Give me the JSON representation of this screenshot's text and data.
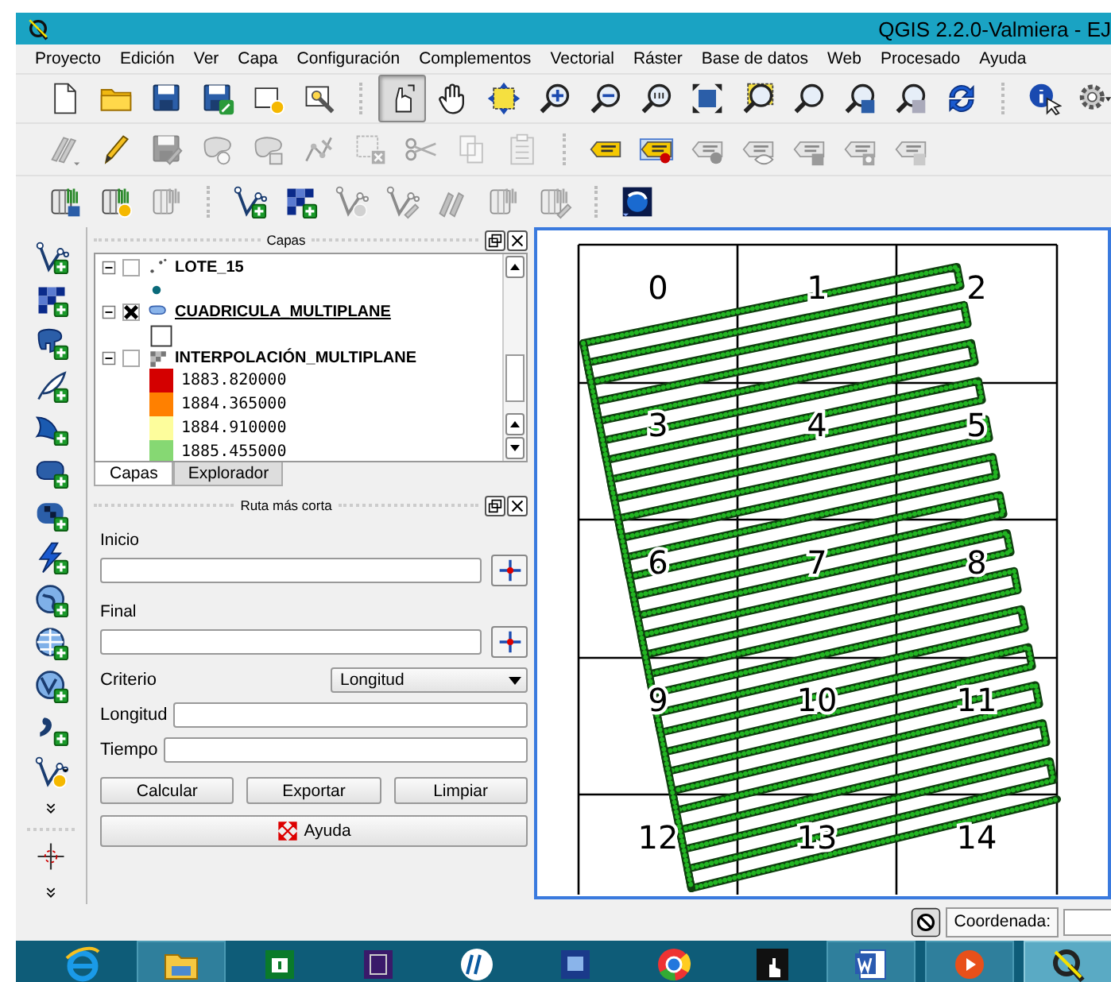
{
  "window": {
    "title": "QGIS 2.2.0-Valmiera - EJ"
  },
  "menu": [
    "Proyecto",
    "Edición",
    "Ver",
    "Capa",
    "Configuración",
    "Complementos",
    "Vectorial",
    "Ráster",
    "Base de datos",
    "Web",
    "Procesado",
    "Ayuda"
  ],
  "toolbars": [
    {
      "tools": [
        {
          "selected": false
        },
        {
          "selected": false
        },
        {
          "selected": false
        },
        {
          "selected": false
        },
        {
          "selected": false
        },
        {
          "selected": false
        },
        {
          "selected": true
        },
        {
          "selected": false
        },
        {
          "selected": false
        },
        {
          "selected": false
        },
        {
          "selected": false
        },
        {
          "selected": false
        },
        {
          "selected": false
        },
        {
          "selected": false
        },
        {
          "selected": false
        },
        {
          "selected": false
        },
        {
          "selected": false
        },
        {
          "selected": false
        },
        {
          "selected": false
        },
        {
          "selected": false
        }
      ]
    },
    {
      "tools": [
        {
          "disabled": true
        },
        {
          "disabled": false
        },
        {
          "disabled": true
        },
        {
          "disabled": true
        },
        {
          "disabled": true
        },
        {
          "disabled": true
        },
        {
          "disabled": true
        },
        {
          "disabled": true
        },
        {
          "disabled": true
        },
        {
          "disabled": true
        },
        {
          "disabled": false
        },
        {
          "disabled": false
        },
        {
          "disabled": true
        },
        {
          "disabled": true
        },
        {
          "disabled": true
        },
        {
          "disabled": true
        },
        {
          "disabled": true
        }
      ]
    },
    {
      "tools": [
        {
          "disabled": false
        },
        {
          "disabled": false
        },
        {
          "disabled": true
        },
        {
          "disabled": false
        },
        {
          "disabled": false
        },
        {
          "disabled": true
        },
        {
          "disabled": true
        },
        {
          "disabled": true
        },
        {
          "disabled": true
        },
        {
          "disabled": true
        },
        {
          "disabled": false
        }
      ]
    }
  ],
  "layers_panel": {
    "title": "Capas",
    "layers": [
      {
        "name": "LOTE_15",
        "kind": "point",
        "checked": false,
        "expanded": true,
        "selected": false
      },
      {
        "name": "CUADRICULA_MULTIPLANE",
        "kind": "polygon",
        "checked": true,
        "expanded": true,
        "selected": true
      },
      {
        "name": "INTERPOLACIÓN_MULTIPLANE",
        "kind": "raster",
        "checked": false,
        "expanded": true,
        "selected": false,
        "legend": [
          {
            "label": "1883.820000",
            "color": "#d40000"
          },
          {
            "label": "1884.365000",
            "color": "#ff8000"
          },
          {
            "label": "1884.910000",
            "color": "#fdfd9c"
          },
          {
            "label": "1885.455000",
            "color": "#86d873"
          }
        ]
      }
    ],
    "tabs": [
      {
        "label": "Capas",
        "selected": true
      },
      {
        "label": "Explorador",
        "selected": false
      }
    ]
  },
  "route_panel": {
    "title": "Ruta más corta",
    "start": {
      "label": "Inicio"
    },
    "end": {
      "label": "Final"
    },
    "criterion": {
      "label": "Criterio",
      "value": "Longitud"
    },
    "length": {
      "label": "Longitud"
    },
    "time": {
      "label": "Tiempo"
    },
    "buttons": [
      "Calcular",
      "Exportar",
      "Limpiar"
    ],
    "help_button": "Ayuda"
  },
  "map": {
    "cell_labels": [
      "0",
      "1",
      "2",
      "3",
      "4",
      "5",
      "6",
      "7",
      "8",
      "9",
      "10",
      "11",
      "12",
      "13",
      "14"
    ]
  },
  "status_bar": {
    "coordinate_label": "Coordenada:"
  },
  "taskbar": {
    "apps": [
      {
        "open": false,
        "selected": false
      },
      {
        "open": true,
        "selected": false
      },
      {
        "open": false,
        "selected": false
      },
      {
        "open": false,
        "selected": false
      },
      {
        "open": false,
        "selected": false
      },
      {
        "open": false,
        "selected": false
      },
      {
        "open": false,
        "selected": false
      },
      {
        "open": false,
        "selected": false
      },
      {
        "open": true,
        "selected": false
      },
      {
        "open": true,
        "selected": false
      },
      {
        "open": true,
        "selected": true
      }
    ]
  }
}
